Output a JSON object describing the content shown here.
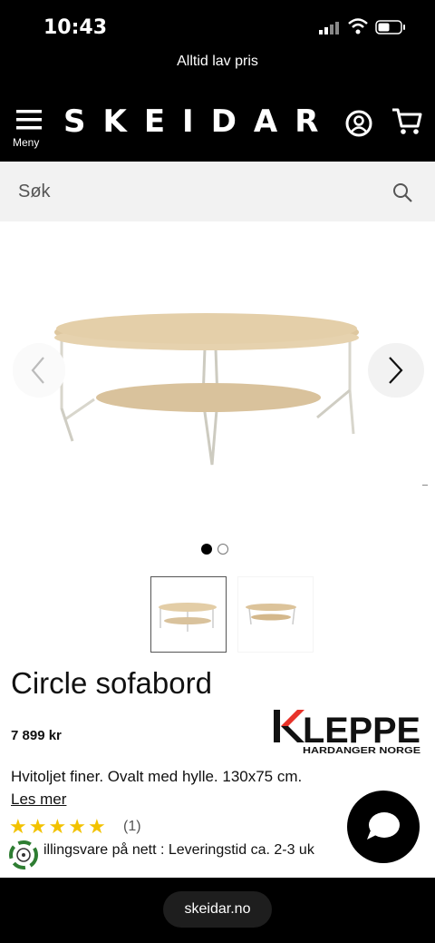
{
  "status_bar": {
    "time": "10:43"
  },
  "promo": {
    "text": "Alltid lav pris"
  },
  "header": {
    "logo": "SKEIDAR",
    "menu_label": "Meny"
  },
  "search": {
    "placeholder": "Søk"
  },
  "gallery": {
    "image_count": 2,
    "active_index": 0
  },
  "product": {
    "title": "Circle sofabord",
    "price": "7 899 kr",
    "brand": {
      "name": "KLEPPE",
      "tagline": "HARDANGER NORGE"
    },
    "description": "Hvitoljet finer. Ovalt med hylle. 130x75 cm.",
    "read_more": "Les mer",
    "rating": {
      "stars": 5,
      "count": "(1)"
    },
    "delivery": "illingsvare på nett : Leveringstid ca. 2-3 uk"
  },
  "browser": {
    "url": "skeidar.no"
  },
  "colors": {
    "header_bg": "#000000",
    "star": "#f2c200",
    "search_bg": "#f2f2f2",
    "brand_red": "#e8332a"
  }
}
